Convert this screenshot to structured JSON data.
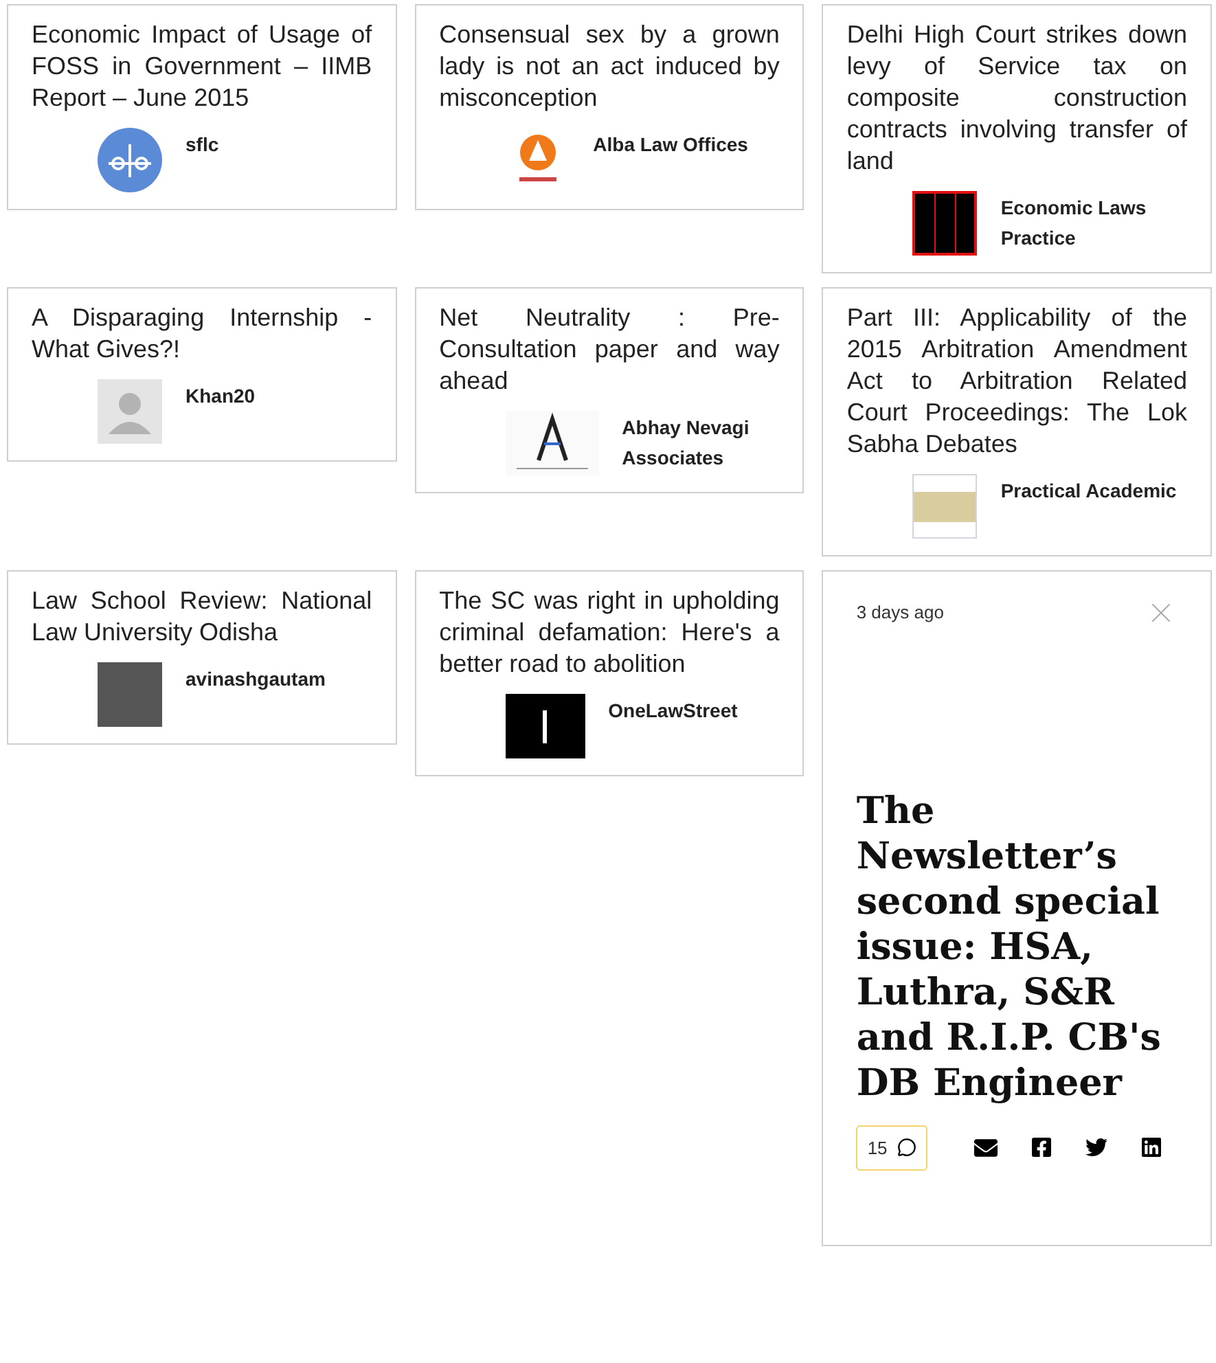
{
  "cards": [
    {
      "title": "Economic Impact of Usage of FOSS in Government – IIMB Report – June 2015",
      "author": "sflc",
      "kind": "scales"
    },
    {
      "title": "Consensual sex by a grown lady is not an act induced by misconception",
      "author": "Alba Law Offices",
      "kind": "flame"
    },
    {
      "title": "Delhi High Court strikes down levy of Service tax on composite construction contracts involving transfer of land",
      "author": "Economic Laws Practice",
      "kind": "pillars"
    },
    {
      "title": "A Disparaging Internship - What Gives?!",
      "author": "Khan20",
      "kind": "silhouette"
    },
    {
      "title": "Net Neutrality : Pre-Consultation paper and way ahead",
      "author": "Abhay Nevagi Associates",
      "kind": "letter"
    },
    {
      "title": "Part III: Applicability of the 2015 Arbitration Amendment Act to Arbitration Related Court Proceedings: The Lok Sabha Debates",
      "author": "Practical Academic",
      "kind": "paper"
    },
    {
      "title": "Law School Review: National Law University Odisha",
      "author": "avinashgautam",
      "kind": "photo"
    },
    {
      "title": "The SC was right in upholding criminal defamation: Here's a better road to abolition",
      "author": "OneLawStreet",
      "kind": "dark"
    }
  ],
  "newsletter": {
    "time": "3 days ago",
    "title": "The Newsletter’s second special issue: HSA, Luthra, S&R and R.I.P. CB's DB Engineer",
    "comments": "15"
  }
}
